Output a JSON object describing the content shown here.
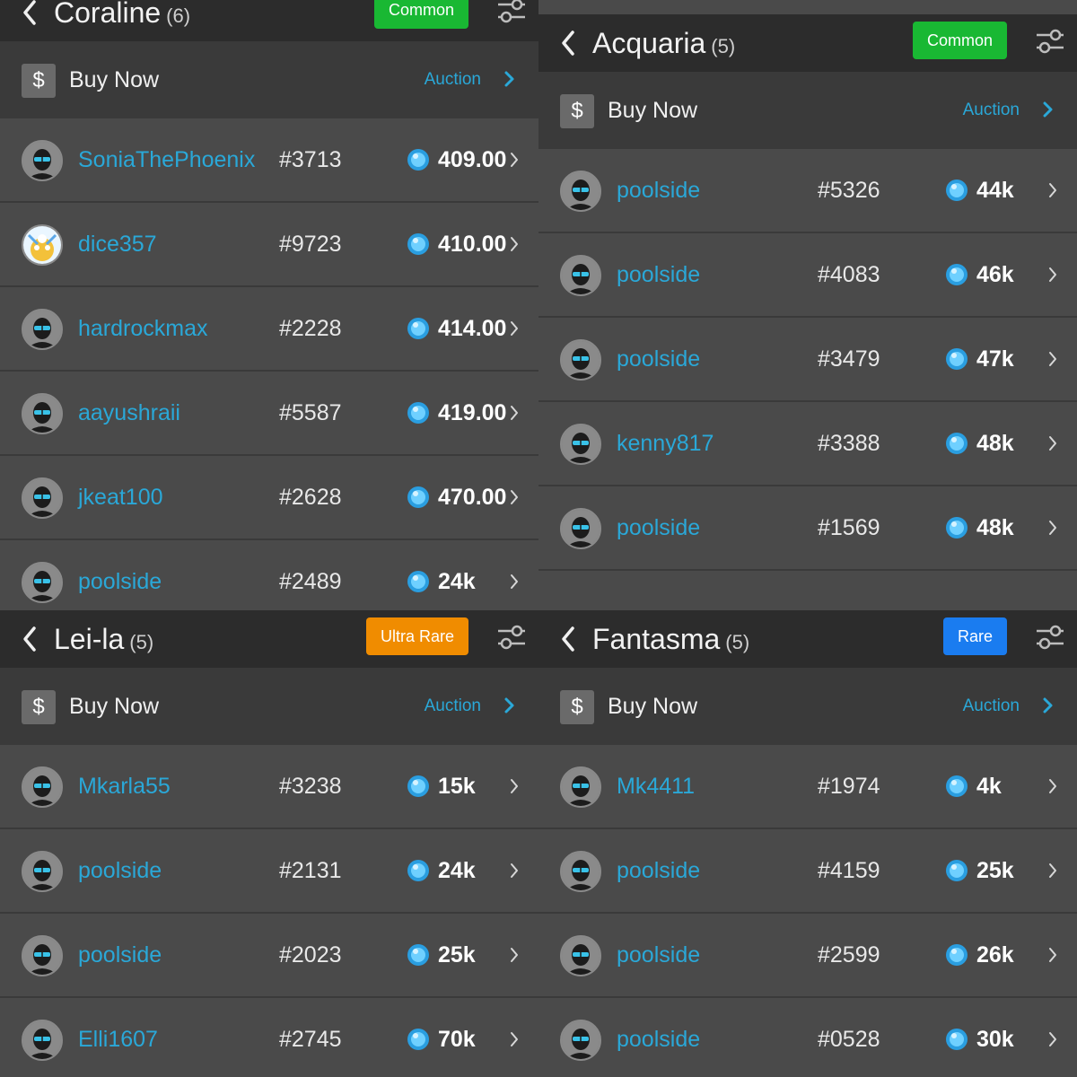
{
  "colors": {
    "common": "#19b833",
    "ultra_rare": "#f08c00",
    "rare": "#1a7cf0",
    "accent": "#2aa8d8"
  },
  "panels": [
    {
      "title": "Coraline",
      "count": "(6)",
      "badge": "Common",
      "badge_color": "#19b833",
      "buy_now": "Buy Now",
      "auction": "Auction",
      "currency_symbol": "$",
      "rows": [
        {
          "user": "SoniaThePhoenix",
          "serial": "#3713",
          "price": "409.00",
          "avatar": "masked"
        },
        {
          "user": "dice357",
          "serial": "#9723",
          "price": "410.00",
          "avatar": "mascot"
        },
        {
          "user": "hardrockmax",
          "serial": "#2228",
          "price": "414.00",
          "avatar": "masked"
        },
        {
          "user": "aayushraii",
          "serial": "#5587",
          "price": "419.00",
          "avatar": "masked"
        },
        {
          "user": "jkeat100",
          "serial": "#2628",
          "price": "470.00",
          "avatar": "masked"
        },
        {
          "user": "poolside",
          "serial": "#2489",
          "price": "24k",
          "avatar": "masked"
        }
      ]
    },
    {
      "title": "Acquaria",
      "count": "(5)",
      "badge": "Common",
      "badge_color": "#19b833",
      "buy_now": "Buy Now",
      "auction": "Auction",
      "currency_symbol": "$",
      "rows": [
        {
          "user": "poolside",
          "serial": "#5326",
          "price": "44k",
          "avatar": "masked"
        },
        {
          "user": "poolside",
          "serial": "#4083",
          "price": "46k",
          "avatar": "masked"
        },
        {
          "user": "poolside",
          "serial": "#3479",
          "price": "47k",
          "avatar": "masked"
        },
        {
          "user": "kenny817",
          "serial": "#3388",
          "price": "48k",
          "avatar": "masked"
        },
        {
          "user": "poolside",
          "serial": "#1569",
          "price": "48k",
          "avatar": "masked"
        }
      ]
    },
    {
      "title": "Lei-la",
      "count": "(5)",
      "badge": "Ultra Rare",
      "badge_color": "#f08c00",
      "buy_now": "Buy Now",
      "auction": "Auction",
      "currency_symbol": "$",
      "rows": [
        {
          "user": "Mkarla55",
          "serial": "#3238",
          "price": "15k",
          "avatar": "masked"
        },
        {
          "user": "poolside",
          "serial": "#2131",
          "price": "24k",
          "avatar": "masked"
        },
        {
          "user": "poolside",
          "serial": "#2023",
          "price": "25k",
          "avatar": "masked"
        },
        {
          "user": "Elli1607",
          "serial": "#2745",
          "price": "70k",
          "avatar": "masked"
        }
      ]
    },
    {
      "title": "Fantasma",
      "count": "(5)",
      "badge": "Rare",
      "badge_color": "#1a7cf0",
      "buy_now": "Buy Now",
      "auction": "Auction",
      "currency_symbol": "$",
      "rows": [
        {
          "user": "Mk4411",
          "serial": "#1974",
          "price": "4k",
          "avatar": "masked"
        },
        {
          "user": "poolside",
          "serial": "#4159",
          "price": "25k",
          "avatar": "masked"
        },
        {
          "user": "poolside",
          "serial": "#2599",
          "price": "26k",
          "avatar": "masked"
        },
        {
          "user": "poolside",
          "serial": "#0528",
          "price": "30k",
          "avatar": "masked"
        }
      ]
    }
  ]
}
